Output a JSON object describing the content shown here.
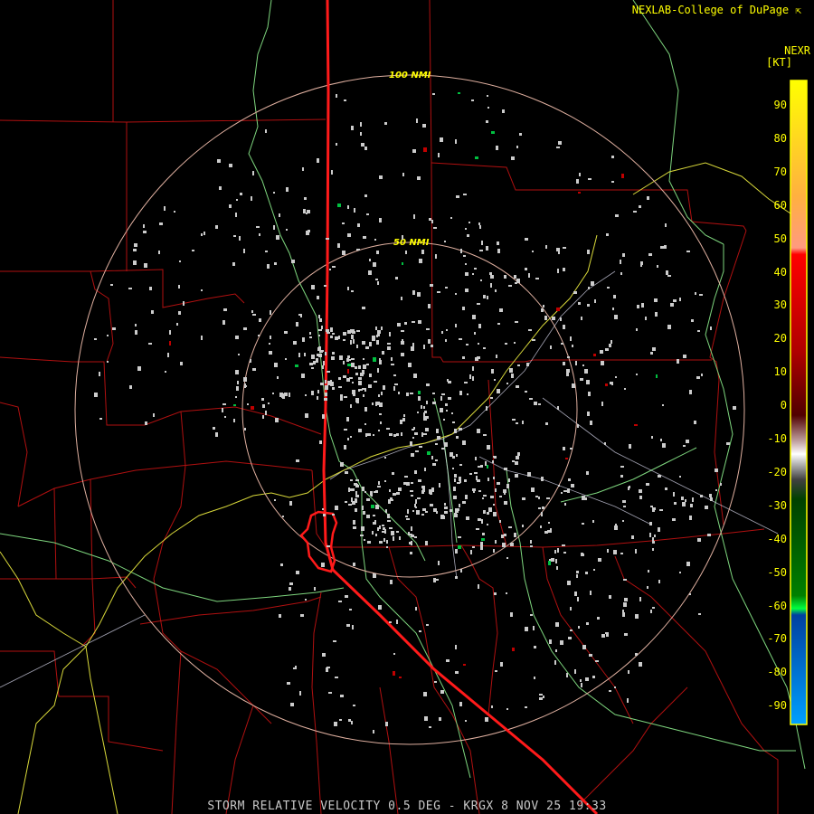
{
  "header": {
    "credit": "NEXLAB-College of DuPage",
    "credit_icon": "cursor-arrow-icon"
  },
  "legend": {
    "product": "NEXR",
    "unit": "[KT]",
    "ticks": [
      "90",
      "80",
      "70",
      "60",
      "50",
      "40",
      "30",
      "20",
      "10",
      "0",
      "-10",
      "-20",
      "-30",
      "-40",
      "-50",
      "-60",
      "-70",
      "-80",
      "-90"
    ],
    "colorbar_range": [
      -95,
      95
    ]
  },
  "rings": [
    {
      "label": "100 NMI",
      "range_nmi": 100
    },
    {
      "label": "50 NMI",
      "range_nmi": 50
    }
  ],
  "footer": {
    "text": "STORM RELATIVE VELOCITY 0.5 DEG - KRGX 8 NOV 25 19:33"
  },
  "colors": {
    "background": "#000000",
    "county_lines": "#b01010",
    "highway": "#ff1a1a",
    "state_road": "#e8e8ff",
    "rivers": "#7ed67e",
    "ring": "#e0b0a0",
    "text_yellow": "#ffff00",
    "echo": "#cccccc"
  }
}
